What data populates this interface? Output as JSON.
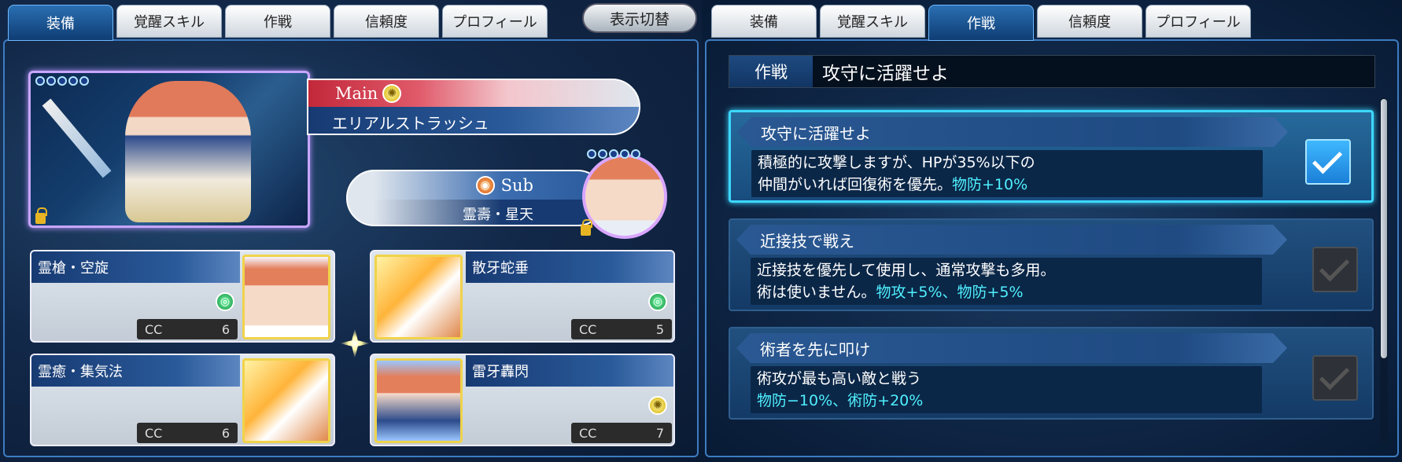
{
  "left_panel": {
    "tabs": [
      {
        "label": "装備",
        "active": true
      },
      {
        "label": "覚醒スキル",
        "active": false
      },
      {
        "label": "作戦",
        "active": false
      },
      {
        "label": "信頼度",
        "active": false
      },
      {
        "label": "プロフィール",
        "active": false
      }
    ],
    "toggle_button": "表示切替",
    "main": {
      "label": "Main",
      "skill": "エリアルストラッシュ",
      "element_icon": "light-element-icon"
    },
    "sub": {
      "label": "Sub",
      "skill": "霊壽・星天",
      "element_icon": "fire-element-icon"
    },
    "skills": [
      {
        "name": "霊槍・空旋",
        "cc_label": "CC",
        "cc": "6",
        "element_icon": "wind-element-icon"
      },
      {
        "name": "散牙蛇垂",
        "cc_label": "CC",
        "cc": "5",
        "element_icon": "wind-element-icon"
      },
      {
        "name": "霊癒・集気法",
        "cc_label": "CC",
        "cc": "6",
        "element_icon": ""
      },
      {
        "name": "雷牙轟閃",
        "cc_label": "CC",
        "cc": "7",
        "element_icon": "light-element-icon"
      }
    ]
  },
  "right_panel": {
    "tabs": [
      {
        "label": "装備",
        "active": false
      },
      {
        "label": "覚醒スキル",
        "active": false
      },
      {
        "label": "作戦",
        "active": true
      },
      {
        "label": "信頼度",
        "active": false
      },
      {
        "label": "プロフィール",
        "active": false
      }
    ],
    "tactic_header": {
      "label": "作戦",
      "value": "攻守に活躍せよ"
    },
    "options": [
      {
        "title": "攻守に活躍せよ",
        "line1": "積極的に攻撃しますが、HPが35%以下の",
        "line2_plain": "仲間がいれば回復術を優先。",
        "line2_highlight": "物防+10%",
        "checked": true
      },
      {
        "title": "近接技で戦え",
        "line1": "近接技を優先して使用し、通常攻撃も多用。",
        "line2_plain": "術は使いません。",
        "line2_highlight": "物攻+5%、物防+5%",
        "checked": false
      },
      {
        "title": "術者を先に叩け",
        "line1": "術攻が最も高い敵と戦う",
        "line2_plain": "",
        "line2_highlight": "物防−10%、術防+20%",
        "checked": false
      }
    ]
  },
  "colors": {
    "active_tab": "#1f5a98",
    "highlight_text": "#4ff0ff",
    "check_on": "#2c9cf0",
    "cc_box": "#2b2b2b"
  }
}
